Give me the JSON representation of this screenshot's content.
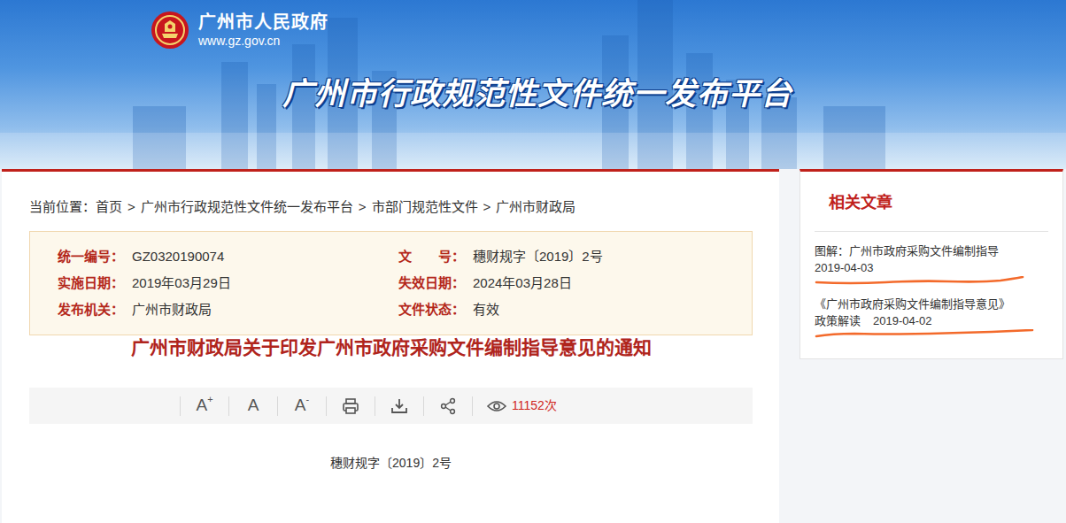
{
  "site": {
    "name": "广州市人民政府",
    "url": "www.gz.gov.cn",
    "platform_title": "广州市行政规范性文件统一发布平台"
  },
  "breadcrumb": {
    "label": "当前位置：",
    "separator": ">",
    "items": [
      "首页",
      "广州市行政规范性文件统一发布平台",
      "市部门规范性文件",
      "广州市财政局"
    ]
  },
  "meta": [
    {
      "label": "统一编号：",
      "value": "GZ0320190074"
    },
    {
      "label": "文　　号：",
      "value": "穗财规字〔2019〕2号"
    },
    {
      "label": "实施日期：",
      "value": "2019年03月29日"
    },
    {
      "label": "失效日期：",
      "value": "2024年03月28日"
    },
    {
      "label": "发布机关：",
      "value": "广州市财政局"
    },
    {
      "label": "文件状态：",
      "value": "有效"
    }
  ],
  "document": {
    "title": "广州市财政局关于印发广州市政府采购文件编制指导意见的通知",
    "doc_number": "穗财规字〔2019〕2号"
  },
  "toolbar": {
    "font_buttons": [
      {
        "letter": "A",
        "sign": "+"
      },
      {
        "letter": "A",
        "sign": ""
      },
      {
        "letter": "A",
        "sign": "-"
      }
    ],
    "views": "11152次"
  },
  "related": {
    "title": "相关文章",
    "items": [
      {
        "title": "图解：广州市政府采购文件编制指导",
        "date": "2019-04-03",
        "annotated": true
      },
      {
        "title": "《广州市政府采购文件编制指导意见》",
        "category": "政策解读",
        "date": "2019-04-02",
        "annotated": true
      }
    ]
  }
}
